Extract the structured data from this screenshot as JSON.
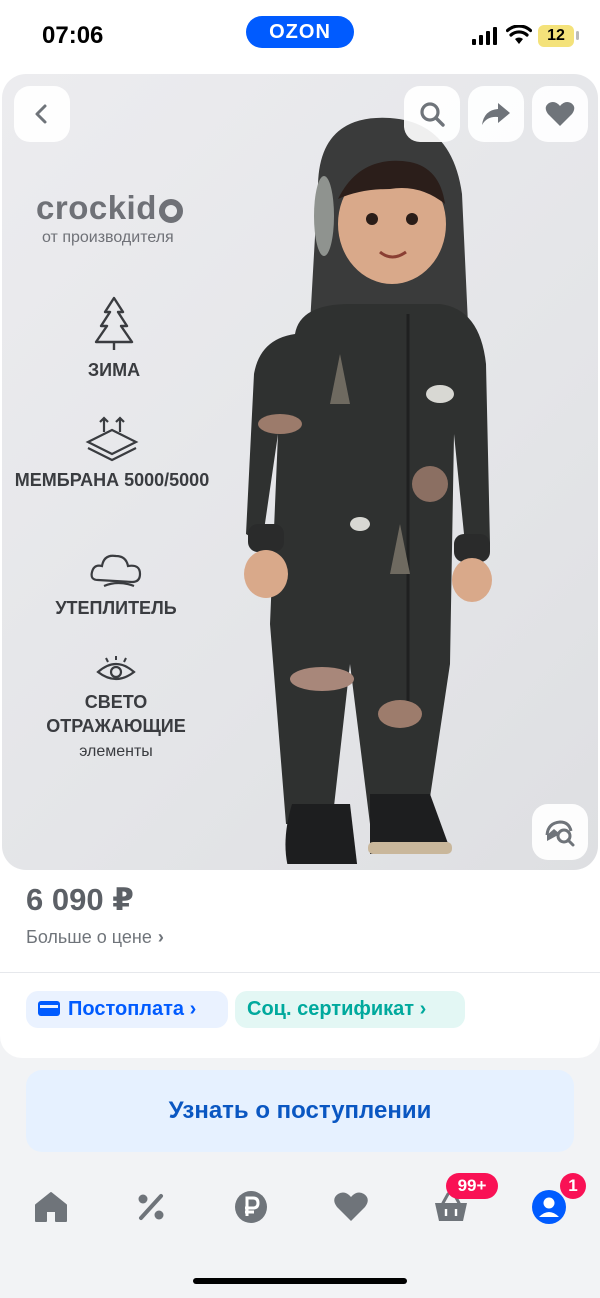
{
  "status": {
    "time": "07:06",
    "logo": "OZON",
    "battery": "12"
  },
  "product": {
    "brand": "crockid",
    "brand_sub": "от производителя",
    "features": [
      {
        "icon": "tree-icon",
        "label": "ЗИМА"
      },
      {
        "icon": "membrane-icon",
        "label": "МЕМБРАНА 5000/5000"
      },
      {
        "icon": "cloud-icon",
        "label": "УТЕПЛИТЕЛЬ"
      },
      {
        "icon": "eye-icon",
        "label": "СВЕТО ОТРАЖАЮЩИЕ",
        "sub": "элементы"
      }
    ],
    "price": "6 090 ₽",
    "price_more": "Больше о цене",
    "chips": [
      {
        "label": "Постоплата",
        "color": "#005bff"
      },
      {
        "label": "Соц. сертификат",
        "color": "#00a99d"
      }
    ]
  },
  "actions": {
    "notify_label": "Узнать о поступлении"
  },
  "tabbar": {
    "items": [
      {
        "icon": "home-icon"
      },
      {
        "icon": "percent-icon"
      },
      {
        "icon": "ruble-icon"
      },
      {
        "icon": "heart-icon"
      },
      {
        "icon": "basket-icon",
        "badge": "99+"
      },
      {
        "icon": "profile-icon",
        "badge": "1"
      }
    ]
  },
  "colors": {
    "accent": "#005bff",
    "badge": "#f91155",
    "teal": "#00a99d"
  }
}
